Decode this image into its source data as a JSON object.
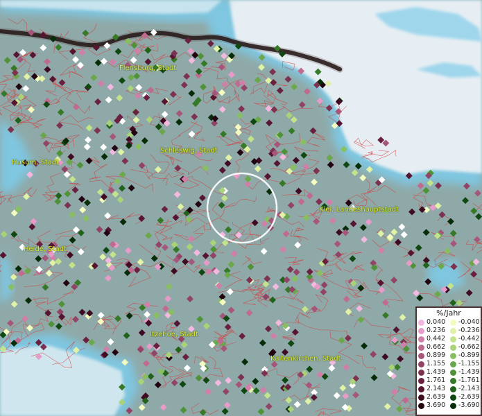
{
  "cities": [
    {
      "name": "Flensburg, Stadt"
    },
    {
      "name": "Schleswig, Stadt"
    },
    {
      "name": "Husum, Stadt"
    },
    {
      "name": "Kiel, Landeshauptstadt"
    },
    {
      "name": "Heide, Stadt"
    },
    {
      "name": "Itzehoe, Stadt"
    },
    {
      "name": "Kaltenkirchen, Stadt"
    }
  ],
  "legend": {
    "title": "%/Jahr",
    "positive": [
      {
        "value": "0.040",
        "color": "#f3b8df"
      },
      {
        "value": "0.236",
        "color": "#e79bc8"
      },
      {
        "value": "0.442",
        "color": "#d07fa8"
      },
      {
        "value": "0.662",
        "color": "#c06a90"
      },
      {
        "value": "0.899",
        "color": "#a6567a"
      },
      {
        "value": "1.155",
        "color": "#924466"
      },
      {
        "value": "1.439",
        "color": "#7d3250"
      },
      {
        "value": "1.761",
        "color": "#6a2140"
      },
      {
        "value": "2.143",
        "color": "#561530"
      },
      {
        "value": "2.639",
        "color": "#3f0b20"
      },
      {
        "value": "3.690",
        "color": "#220411"
      }
    ],
    "negative": [
      {
        "value": "-0.040",
        "color": "#f4fbbf"
      },
      {
        "value": "-0.236",
        "color": "#dff2a6"
      },
      {
        "value": "-0.442",
        "color": "#c4e48c"
      },
      {
        "value": "-0.662",
        "color": "#a8d477"
      },
      {
        "value": "-0.899",
        "color": "#88bf60"
      },
      {
        "value": "-1.155",
        "color": "#6aa84b"
      },
      {
        "value": "-1.439",
        "color": "#4f9238"
      },
      {
        "value": "-1.761",
        "color": "#367a28"
      },
      {
        "value": "-2.143",
        "color": "#22631b"
      },
      {
        "value": "-2.639",
        "color": "#0f4810"
      },
      {
        "value": "-3.690",
        "color": "#062c08"
      }
    ]
  },
  "colors": {
    "land": "#8fa9a8",
    "sea": "#eaf2f6",
    "coast": "#7fc6e0",
    "boundary": "#d63838",
    "border_line": "#1a1010",
    "label": "#e4e832",
    "highlight_circle": "#ffffff"
  }
}
